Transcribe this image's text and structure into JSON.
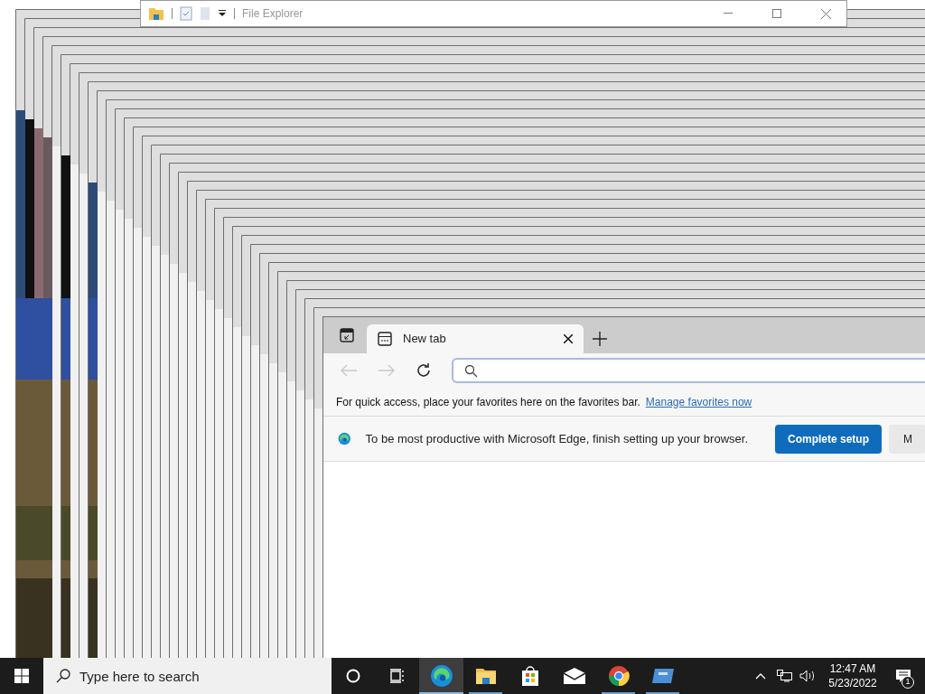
{
  "stacked_windows": [
    {
      "kind": "picture"
    },
    {
      "kind": "picture"
    },
    {
      "kind": "picture"
    },
    {
      "kind": "picture"
    },
    {
      "kind": "blank"
    },
    {
      "kind": "picture"
    },
    {
      "kind": "blank"
    },
    {
      "kind": "blank"
    },
    {
      "kind": "picture"
    },
    {
      "kind": "blank"
    },
    {
      "kind": "blank"
    },
    {
      "kind": "blank"
    },
    {
      "kind": "blank"
    },
    {
      "kind": "blank"
    },
    {
      "kind": "blank"
    },
    {
      "kind": "blank"
    },
    {
      "kind": "blank"
    },
    {
      "kind": "blank"
    },
    {
      "kind": "blank"
    },
    {
      "kind": "blank"
    },
    {
      "kind": "blank"
    },
    {
      "kind": "blank"
    },
    {
      "kind": "blank"
    },
    {
      "kind": "blank"
    },
    {
      "kind": "blank"
    },
    {
      "kind": "blank"
    },
    {
      "kind": "blank"
    },
    {
      "kind": "blank"
    },
    {
      "kind": "blank"
    },
    {
      "kind": "blank"
    },
    {
      "kind": "blank"
    },
    {
      "kind": "blank"
    },
    {
      "kind": "blank"
    },
    {
      "kind": "blank"
    }
  ],
  "file_explorer": {
    "title": "File Explorer"
  },
  "browser": {
    "tabs": [
      {
        "label": "New tab",
        "selected": true
      }
    ],
    "favorites_bar": {
      "text": "For quick access, place your favorites here on the favorites bar.",
      "link": "Manage favorites now"
    },
    "setup_banner": {
      "text": "To be most productive with Microsoft Edge, finish setting up your browser.",
      "primary_button": "Complete setup",
      "secondary_button": "M"
    }
  },
  "taskbar": {
    "search_placeholder": "Type here to search",
    "apps": [
      {
        "kind": "edge",
        "selected": true,
        "running": true
      },
      {
        "kind": "explorer",
        "selected": false,
        "running": true
      },
      {
        "kind": "store",
        "selected": false,
        "running": false
      },
      {
        "kind": "mail",
        "selected": false,
        "running": false
      },
      {
        "kind": "chrome",
        "selected": false,
        "running": true
      },
      {
        "kind": "remote",
        "selected": false,
        "running": true
      }
    ],
    "time": "12:47 AM",
    "date": "5/23/2022",
    "notification_count": "1"
  }
}
